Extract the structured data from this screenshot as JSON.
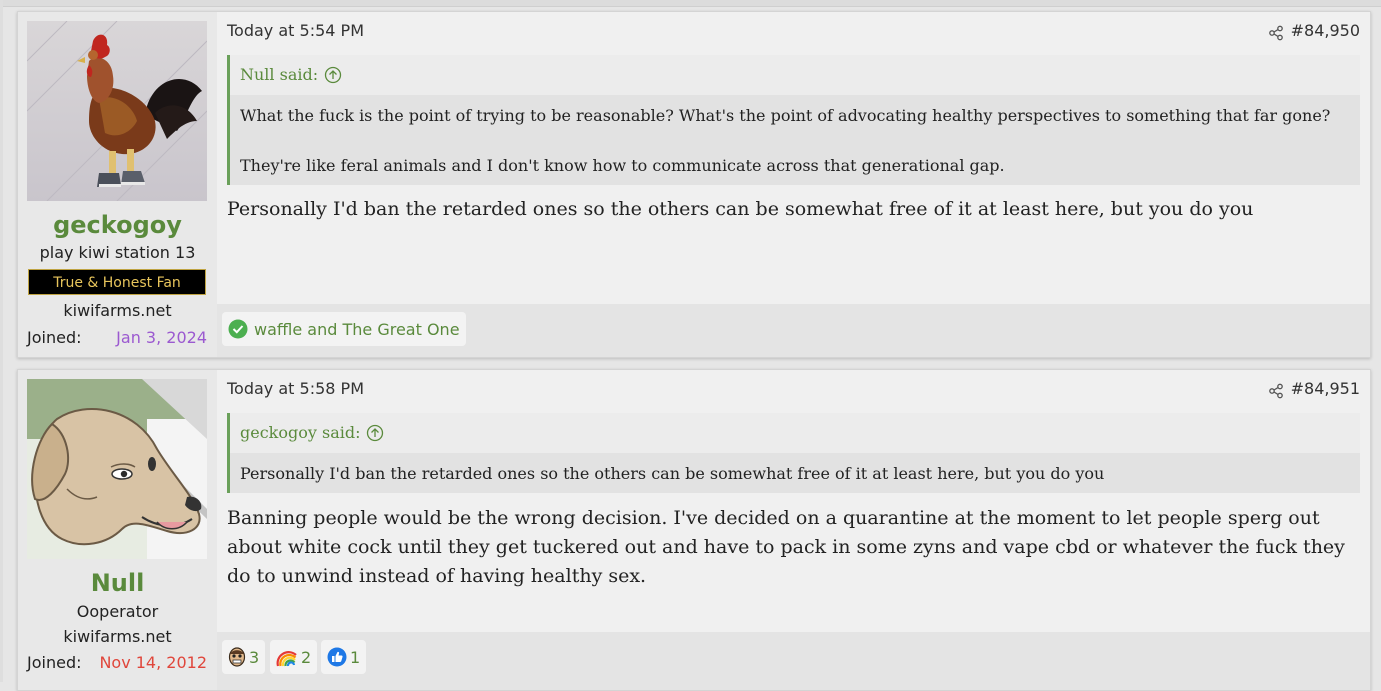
{
  "posts": [
    {
      "user": {
        "name": "geckogoy",
        "title": "play kiwi station 13",
        "banner": "True & Honest Fan",
        "site": "kiwifarms.net",
        "joined_label": "Joined:",
        "joined_date": "Jan 3, 2024",
        "joined_color": "#9b59d0",
        "avatar_icon": "rooster-avatar"
      },
      "timestamp": "Today at 5:54 PM",
      "number": "#84,950",
      "quote": {
        "author": "Null said:",
        "lines": [
          "What the fuck is the point of trying to be reasonable? What's the point of advocating healthy perspectives to something that far gone?",
          "They're like feral animals and I don't know how to communicate across that generational gap."
        ]
      },
      "message": "Personally I'd ban the retarded ones so the others can be somewhat free of it at least here, but you do you",
      "reactions_text": "waffle and The Great One"
    },
    {
      "user": {
        "name": "Null",
        "title": "Ooperator",
        "site": "kiwifarms.net",
        "joined_label": "Joined:",
        "joined_date": "Nov 14, 2012",
        "joined_color": "#e0463b",
        "avatar_icon": "dog-avatar"
      },
      "timestamp": "Today at 5:58 PM",
      "number": "#84,951",
      "quote": {
        "author": "geckogoy said:",
        "lines": [
          "Personally I'd ban the retarded ones so the others can be somewhat free of it at least here, but you do you"
        ]
      },
      "message": "Banning people would be the wrong decision. I've decided on a quarantine at the moment to let people sperg out about white cock until they get tuckered out and have to pack in some zyns and vape cbd or whatever the fuck they do to unwind instead of having healthy sex.",
      "reactions": [
        {
          "icon": "face-reaction-icon",
          "count": "3"
        },
        {
          "icon": "rainbow-reaction-icon",
          "count": "2"
        },
        {
          "icon": "like-reaction-icon",
          "count": "1"
        }
      ]
    }
  ],
  "colors": {
    "accent_green": "#5a8a3c",
    "quote_border": "#6aa05a"
  }
}
